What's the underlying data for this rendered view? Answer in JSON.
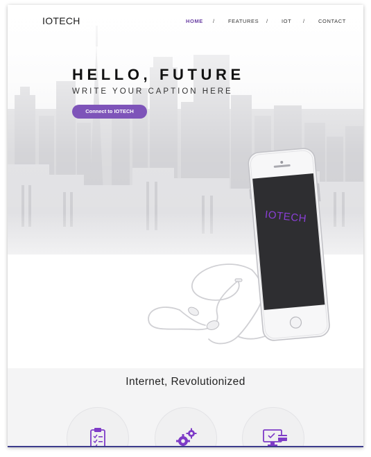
{
  "brand": {
    "logo": "IOTECH"
  },
  "nav": {
    "items": [
      {
        "label": "HOME",
        "active": true
      },
      {
        "label": "FEATURES",
        "active": false
      },
      {
        "label": "IOT",
        "active": false
      },
      {
        "label": "CONTACT",
        "active": false
      }
    ],
    "separator": "/"
  },
  "hero": {
    "title": "HELLO, FUTURE",
    "caption": "WRITE YOUR CAPTION HERE",
    "cta_label": "Connect to IOTECH",
    "phone_screen_text": "IOTECH"
  },
  "section": {
    "title": "Internet, Revolutionized",
    "features": [
      {
        "icon": "clipboard-checklist-icon"
      },
      {
        "icon": "gears-icon"
      },
      {
        "icon": "monitor-card-icon"
      }
    ]
  },
  "colors": {
    "accent": "#7e54b9",
    "nav_active": "#6a3fa3",
    "screen_text": "#8a3fd6",
    "frame_border": "#3c3c8c"
  }
}
